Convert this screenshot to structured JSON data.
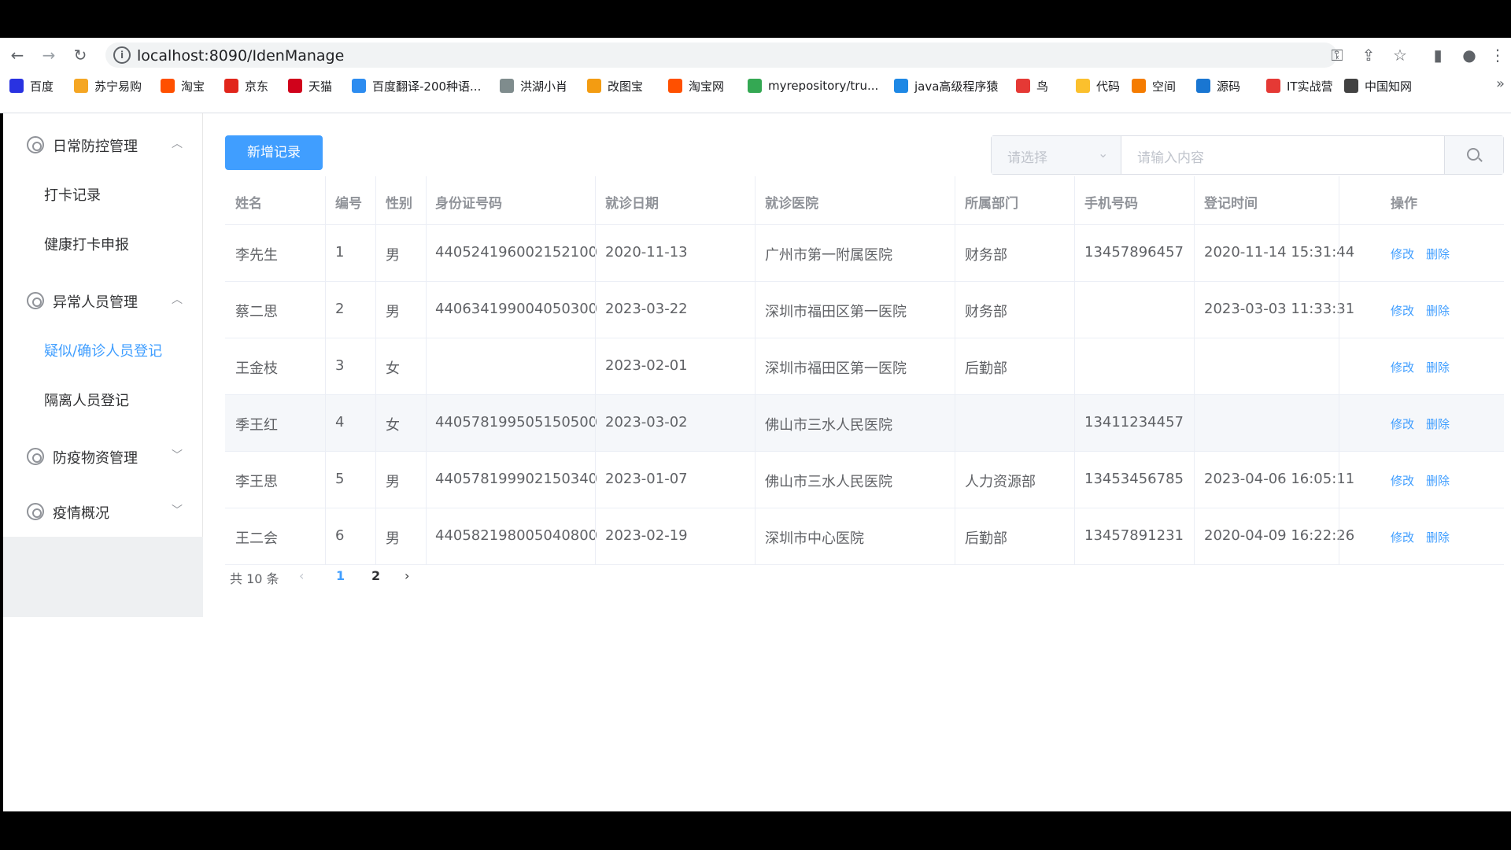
{
  "browser": {
    "url": "localhost:8090/IdenManage",
    "bookmarks": [
      {
        "label": "百度",
        "color": "#2932e1"
      },
      {
        "label": "苏宁易购",
        "color": "#f5a623"
      },
      {
        "label": "淘宝",
        "color": "#ff5000"
      },
      {
        "label": "京东",
        "color": "#e1251b"
      },
      {
        "label": "天猫",
        "color": "#d0021b"
      },
      {
        "label": "百度翻译-200种语...",
        "color": "#2d8cf0"
      },
      {
        "label": "洪湖小肖",
        "color": "#7f8c8d"
      },
      {
        "label": "改图宝",
        "color": "#f39c12"
      },
      {
        "label": "淘宝网",
        "color": "#ff5000"
      },
      {
        "label": "myrepository/tru...",
        "color": "#34a853"
      },
      {
        "label": "java高级程序猿",
        "color": "#1e88e5"
      },
      {
        "label": "鸟",
        "color": "#e53935"
      },
      {
        "label": "代码",
        "color": "#fbc02d"
      },
      {
        "label": "空间",
        "color": "#f57c00"
      },
      {
        "label": "源码",
        "color": "#1976d2"
      },
      {
        "label": "IT实战营",
        "color": "#e53935"
      },
      {
        "label": "中国知网",
        "color": "#424242"
      }
    ]
  },
  "sidebar": {
    "groups": [
      {
        "label": "日常防控管理",
        "expanded": true,
        "items": [
          "打卡记录",
          "健康打卡申报"
        ]
      },
      {
        "label": "异常人员管理",
        "expanded": true,
        "items": [
          "疑似/确诊人员登记",
          "隔离人员登记"
        ]
      },
      {
        "label": "防疫物资管理",
        "expanded": false,
        "items": []
      },
      {
        "label": "疫情概况",
        "expanded": false,
        "items": []
      }
    ],
    "active_item": "疑似/确诊人员登记"
  },
  "toolbar": {
    "add_label": "新增记录",
    "select_placeholder": "请选择",
    "search_placeholder": "请输入内容"
  },
  "table": {
    "columns": [
      "姓名",
      "编号",
      "性别",
      "身份证号码",
      "就诊日期",
      "就诊医院",
      "所属部门",
      "手机号码",
      "登记时间",
      "操作"
    ],
    "rows": [
      [
        "李先生",
        "1",
        "男",
        "440524196002152100",
        "2020-11-13",
        "广州市第一附属医院",
        "财务部",
        "13457896457",
        "2020-11-14 15:31:44"
      ],
      [
        "蔡二思",
        "2",
        "男",
        "440634199004050300",
        "2023-03-22",
        "深圳市福田区第一医院",
        "财务部",
        "",
        "2023-03-03 11:33:31"
      ],
      [
        "王金枝",
        "3",
        "女",
        "",
        "2023-02-01",
        "深圳市福田区第一医院",
        "后勤部",
        "",
        ""
      ],
      [
        "季王红",
        "4",
        "女",
        "440578199505150500",
        "2023-03-02",
        "佛山市三水人民医院",
        "",
        "13411234457",
        ""
      ],
      [
        "李王思",
        "5",
        "男",
        "440578199902150340",
        "2023-01-07",
        "佛山市三水人民医院",
        "人力资源部",
        "13453456785",
        "2023-04-06 16:05:11"
      ],
      [
        "王二会",
        "6",
        "男",
        "440582198005040800",
        "2023-02-19",
        "深圳市中心医院",
        "后勤部",
        "13457891231",
        "2020-04-09 16:22:26"
      ]
    ],
    "edit_label": "修改",
    "delete_label": "删除"
  },
  "pagination": {
    "total_text": "共 10 条",
    "pages": [
      "1",
      "2"
    ],
    "current": "1"
  }
}
